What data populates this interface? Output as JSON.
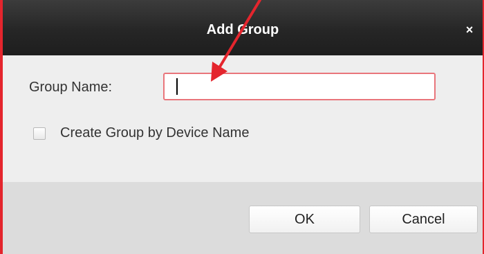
{
  "dialog": {
    "title": "Add Group",
    "close_icon": "close-icon",
    "close_glyph": "×"
  },
  "form": {
    "group_name_label": "Group Name:",
    "group_name_value": "",
    "checkbox_label": "Create Group by Device Name",
    "checkbox_checked": false
  },
  "footer": {
    "ok_label": "OK",
    "cancel_label": "Cancel"
  },
  "colors": {
    "annotation": "#e4252d",
    "input_focus_border": "#e9757b",
    "titlebar": "#262626"
  }
}
